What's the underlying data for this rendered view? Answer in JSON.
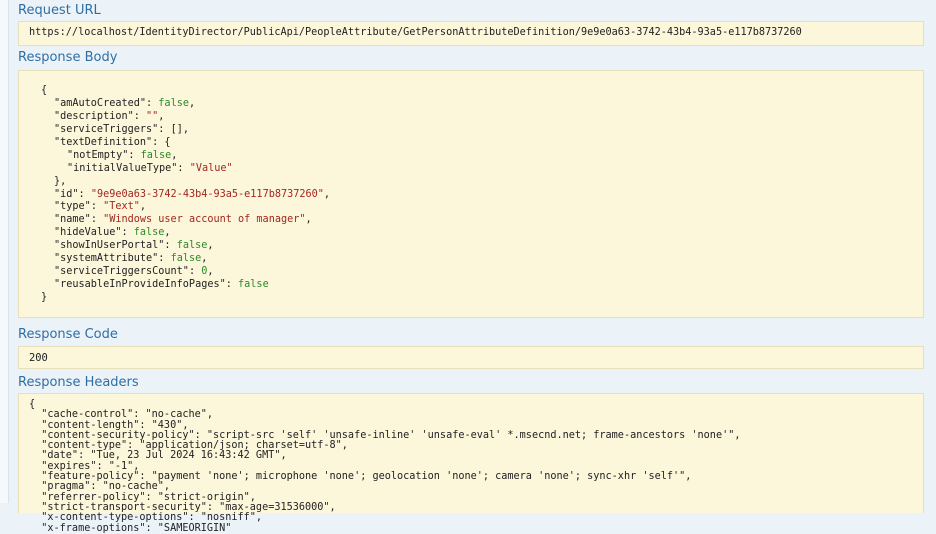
{
  "request_url": {
    "title": "Request URL",
    "value": "https://localhost/IdentityDirector/PublicApi/PeopleAttribute/GetPersonAttributeDefinition/9e9e0a63-3742-43b4-93a5-e117b8737260"
  },
  "response_body": {
    "title": "Response Body",
    "open_brace": "{",
    "close_brace": "}",
    "lines": [
      {
        "key": "\"amAutoCreated\"",
        "value": "false",
        "type": "bool",
        "trail": ",",
        "indent": 1
      },
      {
        "key": "\"description\"",
        "value": "\"\"",
        "type": "string",
        "trail": ",",
        "indent": 1
      },
      {
        "key": "\"serviceTriggers\"",
        "value": "[]",
        "type": "punct",
        "trail": ",",
        "indent": 1
      },
      {
        "key": "\"textDefinition\"",
        "value": "{",
        "type": "punct",
        "trail": "",
        "indent": 1
      },
      {
        "key": "\"notEmpty\"",
        "value": "false",
        "type": "bool",
        "trail": ",",
        "indent": 2
      },
      {
        "key": "\"initialValueType\"",
        "value": "\"Value\"",
        "type": "string",
        "trail": "",
        "indent": 2
      },
      {
        "key": "",
        "value": "},",
        "type": "punct",
        "trail": "",
        "indent": 1
      },
      {
        "key": "\"id\"",
        "value": "\"9e9e0a63-3742-43b4-93a5-e117b8737260\"",
        "type": "string",
        "trail": ",",
        "indent": 1
      },
      {
        "key": "\"type\"",
        "value": "\"Text\"",
        "type": "string",
        "trail": ",",
        "indent": 1
      },
      {
        "key": "\"name\"",
        "value": "\"Windows user account of manager\"",
        "type": "string",
        "trail": ",",
        "indent": 1
      },
      {
        "key": "\"hideValue\"",
        "value": "false",
        "type": "bool",
        "trail": ",",
        "indent": 1
      },
      {
        "key": "\"showInUserPortal\"",
        "value": "false",
        "type": "bool",
        "trail": ",",
        "indent": 1
      },
      {
        "key": "\"systemAttribute\"",
        "value": "false",
        "type": "bool",
        "trail": ",",
        "indent": 1
      },
      {
        "key": "\"serviceTriggersCount\"",
        "value": "0",
        "type": "number",
        "trail": ",",
        "indent": 1
      },
      {
        "key": "\"reusableInProvideInfoPages\"",
        "value": "false",
        "type": "bool",
        "trail": "",
        "indent": 1
      }
    ]
  },
  "response_code": {
    "title": "Response Code",
    "value": "200"
  },
  "response_headers": {
    "title": "Response Headers",
    "lines": [
      "{",
      "  \"cache-control\": \"no-cache\",",
      "  \"content-length\": \"430\",",
      "  \"content-security-policy\": \"script-src 'self' 'unsafe-inline' 'unsafe-eval' *.msecnd.net; frame-ancestors 'none'\",",
      "  \"content-type\": \"application/json; charset=utf-8\",",
      "  \"date\": \"Tue, 23 Jul 2024 16:43:42 GMT\",",
      "  \"expires\": \"-1\",",
      "  \"feature-policy\": \"payment 'none'; microphone 'none'; geolocation 'none'; camera 'none'; sync-xhr 'self'\",",
      "  \"pragma\": \"no-cache\",",
      "  \"referrer-policy\": \"strict-origin\",",
      "  \"strict-transport-security\": \"max-age=31536000\",",
      "  \"x-content-type-options\": \"nosniff\",",
      "  \"x-frame-options\": \"SAMEORIGIN\""
    ]
  }
}
